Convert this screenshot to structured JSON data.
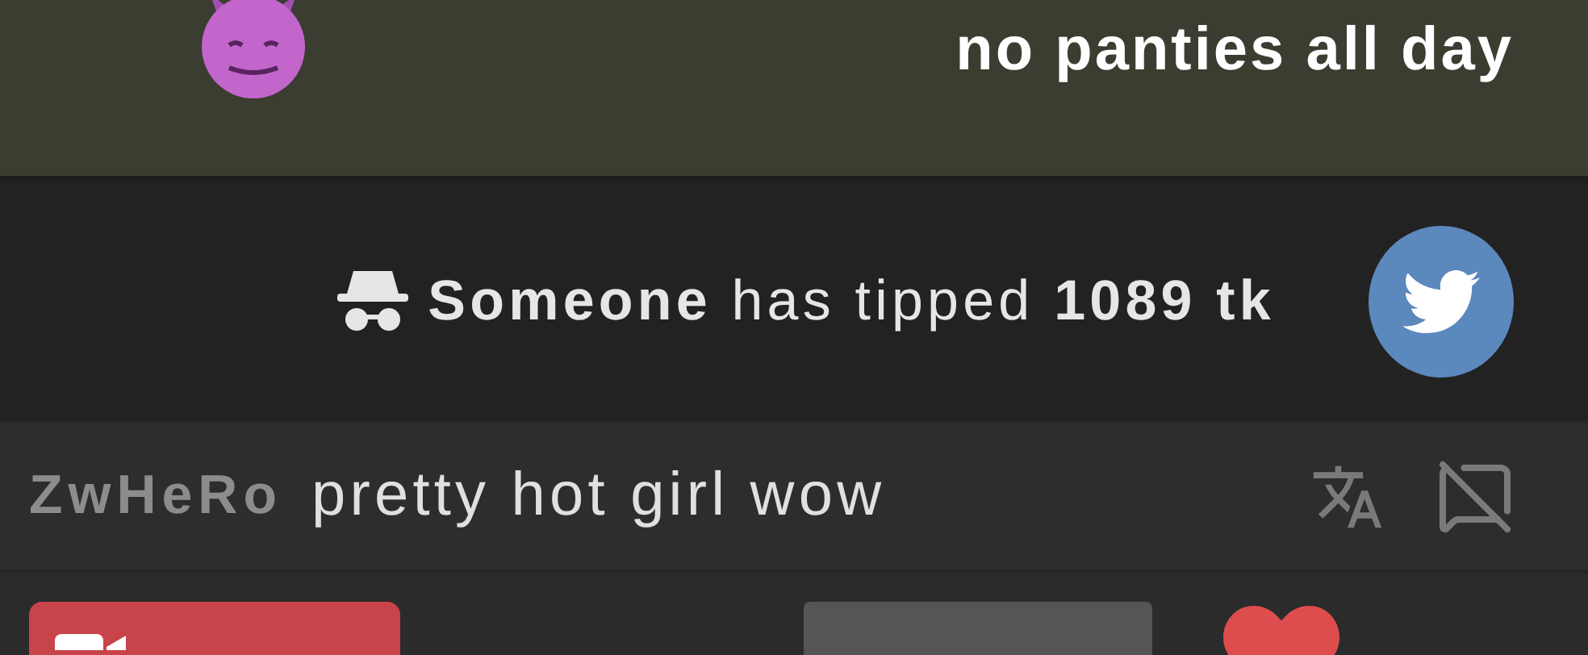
{
  "top_message": {
    "text": "no panties all day"
  },
  "tip_notice": {
    "user": "Someone",
    "middle": "has tipped",
    "amount": "1089 tk"
  },
  "messages": [
    {
      "kind": "chat",
      "username": "ZwHeRo",
      "text": "pretty hot girl wow"
    },
    {
      "kind": "broadcaster_cut"
    }
  ]
}
